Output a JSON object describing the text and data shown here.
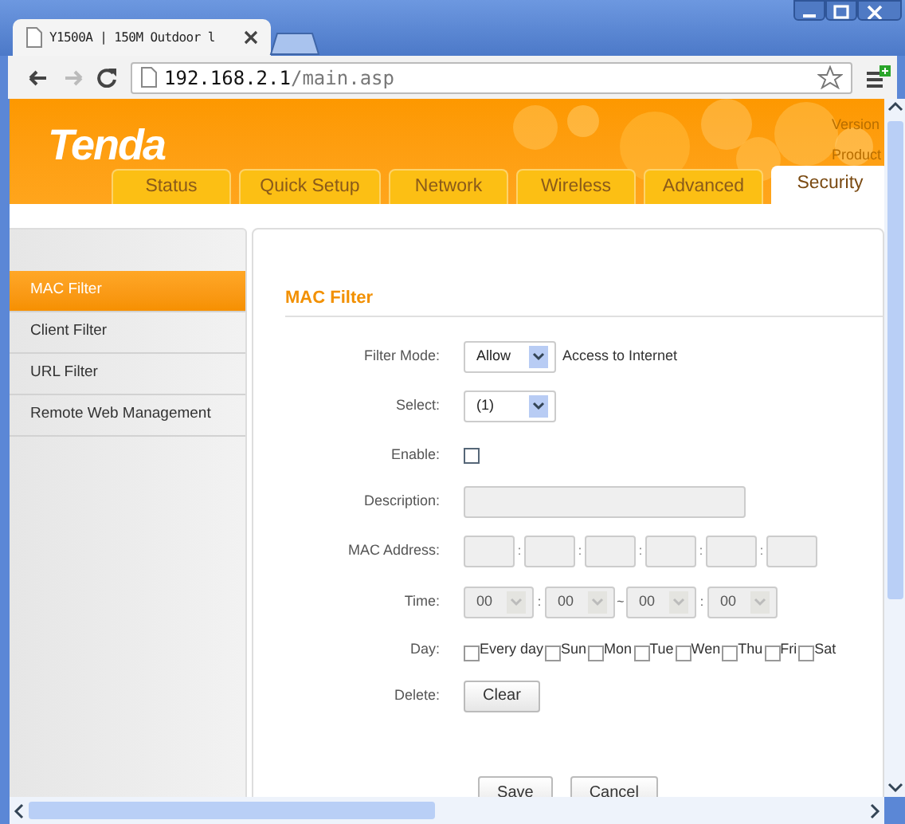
{
  "browser": {
    "tab_title": "Y1500A | 150M Outdoor l",
    "url_host": "192.168.2.1",
    "url_path": "/main.asp"
  },
  "header": {
    "logo": "Tenda",
    "info": [
      "Version",
      "Product"
    ],
    "tabs": [
      {
        "label": "Status",
        "selected": false
      },
      {
        "label": "Quick Setup",
        "selected": false
      },
      {
        "label": "Network",
        "selected": false
      },
      {
        "label": "Wireless",
        "selected": false
      },
      {
        "label": "Advanced",
        "selected": false
      },
      {
        "label": "Security",
        "selected": true
      }
    ]
  },
  "sidebar": {
    "items": [
      {
        "label": "MAC Filter",
        "selected": true
      },
      {
        "label": "Client Filter",
        "selected": false
      },
      {
        "label": "URL Filter",
        "selected": false
      },
      {
        "label": "Remote Web Management",
        "selected": false
      }
    ]
  },
  "form": {
    "title": "MAC Filter",
    "filter_mode": {
      "label": "Filter Mode:",
      "value": "Allow",
      "suffix": "Access to Internet"
    },
    "select": {
      "label": "Select:",
      "value": "(1)"
    },
    "enable": {
      "label": "Enable:",
      "checked": false
    },
    "description": {
      "label": "Description:",
      "disabled": true
    },
    "mac_address": {
      "label": "MAC Address:",
      "disabled": true,
      "separators": [
        ":",
        ":",
        ":",
        ":",
        ":"
      ]
    },
    "time": {
      "label": "Time:",
      "disabled": true,
      "values": [
        "00",
        "00",
        "00",
        "00"
      ],
      "separators": [
        ":",
        "~",
        ":"
      ]
    },
    "day": {
      "label": "Day:",
      "options": [
        {
          "label": "Every day",
          "checked": false
        },
        {
          "label": "Sun",
          "checked": false
        },
        {
          "label": "Mon",
          "checked": false
        },
        {
          "label": "Tue",
          "checked": false
        },
        {
          "label": "Wen",
          "checked": false
        },
        {
          "label": "Thu",
          "checked": false
        },
        {
          "label": "Fri",
          "checked": false
        },
        {
          "label": "Sat",
          "checked": false
        }
      ]
    },
    "delete": {
      "label": "Delete:",
      "button": "Clear"
    },
    "buttons": [
      "Save",
      "Cancel"
    ]
  }
}
